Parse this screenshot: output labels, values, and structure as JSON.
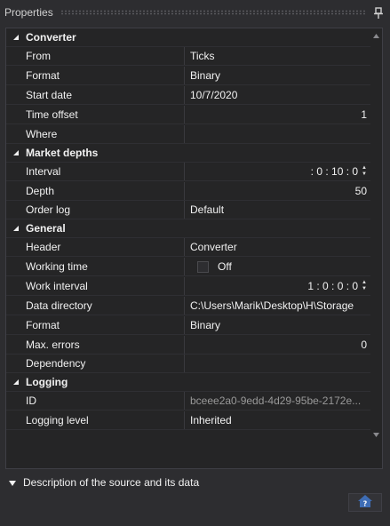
{
  "panel": {
    "title": "Properties"
  },
  "categories": [
    {
      "name": "Converter",
      "properties": [
        {
          "name": "From",
          "value": "Ticks"
        },
        {
          "name": "Format",
          "value": "Binary"
        },
        {
          "name": "Start date",
          "value": "10/7/2020"
        },
        {
          "name": "Time offset",
          "value": "1"
        },
        {
          "name": "Where",
          "value": ""
        }
      ]
    },
    {
      "name": "Market depths",
      "properties": [
        {
          "name": "Interval",
          "value": ": 0 : 10 : 0"
        },
        {
          "name": "Depth",
          "value": "50"
        },
        {
          "name": "Order log",
          "value": "Default"
        }
      ]
    },
    {
      "name": "General",
      "properties": [
        {
          "name": "Header",
          "value": "Converter"
        },
        {
          "name": "Working time",
          "value": "Off"
        },
        {
          "name": "Work interval",
          "value": "1 : 0 : 0 : 0"
        },
        {
          "name": "Data directory",
          "value": "C:\\Users\\Marik\\Desktop\\H\\Storage"
        },
        {
          "name": "Format",
          "value": "Binary"
        },
        {
          "name": "Max. errors",
          "value": "0"
        },
        {
          "name": "Dependency",
          "value": ""
        }
      ]
    },
    {
      "name": "Logging",
      "properties": [
        {
          "name": "ID",
          "value": "bceee2a0-9edd-4d29-95be-2172e..."
        },
        {
          "name": "Logging level",
          "value": "Inherited"
        }
      ]
    }
  ],
  "description": {
    "text": "Description of the source and its data"
  },
  "icons": {
    "pin": "pin-icon",
    "expand": "triangle-down-icon",
    "help": "house-help-icon"
  },
  "colors": {
    "background": "#2d2d30",
    "grid": "#252526",
    "accent": "#3e6db5"
  }
}
